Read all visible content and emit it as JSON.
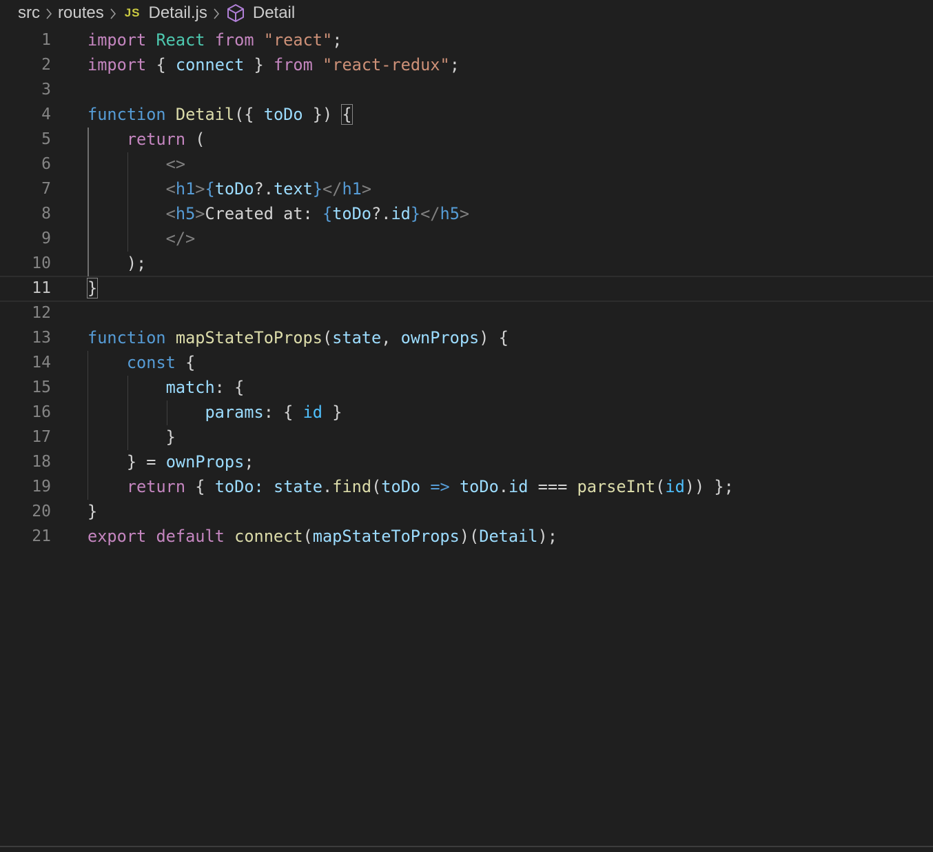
{
  "breadcrumb": {
    "items": [
      "src",
      "routes",
      "Detail.js",
      "Detail"
    ],
    "file_icon_text": "JS"
  },
  "editor": {
    "language": "javascript",
    "current_line": 11,
    "lines": [
      {
        "n": "1",
        "text": "import React from \"react\";"
      },
      {
        "n": "2",
        "text": "import { connect } from \"react-redux\";"
      },
      {
        "n": "3",
        "text": ""
      },
      {
        "n": "4",
        "text": "function Detail({ toDo }) {"
      },
      {
        "n": "5",
        "text": "    return ("
      },
      {
        "n": "6",
        "text": "        <>"
      },
      {
        "n": "7",
        "text": "        <h1>{toDo?.text}</h1>"
      },
      {
        "n": "8",
        "text": "        <h5>Created at: {toDo?.id}</h5>"
      },
      {
        "n": "9",
        "text": "        </>"
      },
      {
        "n": "10",
        "text": "    );"
      },
      {
        "n": "11",
        "text": "}"
      },
      {
        "n": "12",
        "text": ""
      },
      {
        "n": "13",
        "text": "function mapStateToProps(state, ownProps) {"
      },
      {
        "n": "14",
        "text": "    const {"
      },
      {
        "n": "15",
        "text": "        match: {"
      },
      {
        "n": "16",
        "text": "            params: { id }"
      },
      {
        "n": "17",
        "text": "        }"
      },
      {
        "n": "18",
        "text": "    } = ownProps;"
      },
      {
        "n": "19",
        "text": "    return { toDo: state.find(toDo => toDo.id === parseInt(id)) };"
      },
      {
        "n": "20",
        "text": "}"
      },
      {
        "n": "21",
        "text": "export default connect(mapStateToProps)(Detail);"
      }
    ]
  },
  "colors": {
    "background": "#1f1f1f",
    "keyword_control": "#c586c0",
    "keyword_storage": "#569cd6",
    "function": "#dcdcaa",
    "variable": "#9cdcfe",
    "component": "#4ec9b0",
    "string": "#ce9178",
    "line_number": "#858585"
  }
}
